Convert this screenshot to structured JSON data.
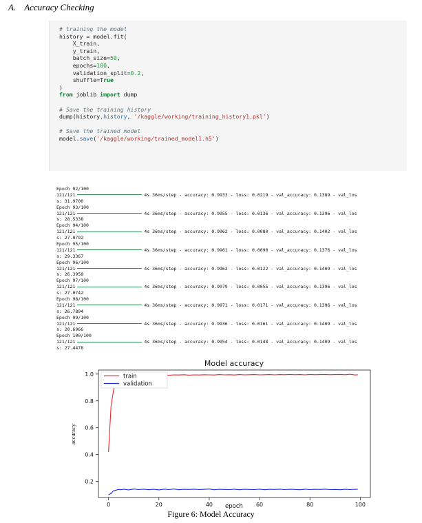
{
  "section": {
    "number": "A.",
    "title": "Accuracy Checking"
  },
  "code": {
    "comment_train": "# training the model",
    "line_fit": "history = model.fit(",
    "arg1": "X_train,",
    "arg2": "y_train,",
    "arg3_key": "batch_size=",
    "arg3_val": "50",
    "arg3_end": ",",
    "arg4_key": "epochs=",
    "arg4_val": "100",
    "arg4_end": ",",
    "arg5_key": "validation_split=",
    "arg5_val": "0.2",
    "arg5_end": ",",
    "arg6_key": "shuffle=",
    "arg6_val": "True",
    "close": ")",
    "import_from": "from",
    "import_mod": " joblib ",
    "import_kw": "import",
    "import_name": " dump",
    "comment_save_hist": "# Save the training history",
    "dump_call": "dump(history.",
    "dump_attr": "history",
    "dump_sep": ", ",
    "dump_path": "'/kaggle/working/training_history1.pkl'",
    "dump_end": ")",
    "comment_save_model": "# Save the trained model",
    "save_obj": "model.",
    "save_fn": "save",
    "save_open": "(",
    "save_path": "'/kaggle/working/trained_model1.h5'",
    "save_end": ")"
  },
  "log": {
    "epochs": [
      {
        "epoch": "Epoch 92/100",
        "step": "121/121",
        "stats": "4s 36ms/step - accuracy: 0.9933 - loss: 0.0219 - val_accuracy: 0.1389 - val_los",
        "tail": "s: 31.9700"
      },
      {
        "epoch": "Epoch 93/100",
        "step": "121/121",
        "stats": "4s 36ms/step - accuracy: 0.9955 - loss: 0.0136 - val_accuracy: 0.1396 - val_los",
        "tail": "s: 28.5338"
      },
      {
        "epoch": "Epoch 94/100",
        "step": "121/121",
        "stats": "4s 36ms/step - accuracy: 0.9962 - loss: 0.0080 - val_accuracy: 0.1402 - val_los",
        "tail": "s: 27.0792"
      },
      {
        "epoch": "Epoch 95/100",
        "step": "121/121",
        "stats": "4s 36ms/step - accuracy: 0.9961 - loss: 0.0090 - val_accuracy: 0.1376 - val_los",
        "tail": "s: 29.3367"
      },
      {
        "epoch": "Epoch 96/100",
        "step": "121/121",
        "stats": "4s 36ms/step - accuracy: 0.9962 - loss: 0.0122 - val_accuracy: 0.1409 - val_los",
        "tail": "s: 26.3958"
      },
      {
        "epoch": "Epoch 97/100",
        "step": "121/121",
        "stats": "4s 36ms/step - accuracy: 0.9979 - loss: 0.0055 - val_accuracy: 0.1396 - val_los",
        "tail": "s: 27.0742"
      },
      {
        "epoch": "Epoch 98/100",
        "step": "121/121",
        "stats": "4s 36ms/step - accuracy: 0.9971 - loss: 0.0171 - val_accuracy: 0.1396 - val_los",
        "tail": "s: 26.7894"
      },
      {
        "epoch": "Epoch 99/100",
        "step": "121/121",
        "stats": "4s 36ms/step - accuracy: 0.9936 - loss: 0.0161 - val_accuracy: 0.1409 - val_los",
        "tail": "s: 20.6966"
      },
      {
        "epoch": "Epoch 100/100",
        "step": "121/121",
        "stats": "4s 36ms/step - accuracy: 0.9954 - loss: 0.0148 - val_accuracy: 0.1409 - val_los",
        "tail": "s: 27.4478"
      }
    ]
  },
  "chart_data": {
    "type": "line",
    "title": "Model accuracy",
    "xlabel": "epoch",
    "ylabel": "accuracy",
    "xlim": [
      -4,
      104
    ],
    "ylim": [
      0.08,
      1.03
    ],
    "xticks": [
      0,
      20,
      40,
      60,
      80,
      100
    ],
    "yticks": [
      0.2,
      0.4,
      0.6,
      0.8,
      1.0
    ],
    "ytick_labels": [
      "0.2",
      "0.4",
      "0.6",
      "0.8",
      "1.0"
    ],
    "legend_position": "top-left",
    "series": [
      {
        "name": "train",
        "color": "#e8262b",
        "x": [
          0,
          1,
          2,
          3,
          4,
          5,
          6,
          7,
          8,
          9,
          10,
          11,
          12,
          13,
          14,
          15,
          16,
          17,
          18,
          19,
          20,
          22,
          24,
          26,
          28,
          30,
          32,
          34,
          36,
          38,
          40,
          42,
          44,
          46,
          48,
          50,
          52,
          54,
          56,
          58,
          60,
          62,
          64,
          66,
          68,
          70,
          72,
          74,
          76,
          78,
          80,
          82,
          84,
          86,
          88,
          90,
          92,
          94,
          96,
          98,
          99
        ],
        "y": [
          0.42,
          0.76,
          0.88,
          0.94,
          0.96,
          0.975,
          0.98,
          0.985,
          0.988,
          0.99,
          0.985,
          0.99,
          0.992,
          0.988,
          0.991,
          0.993,
          0.99,
          0.992,
          0.994,
          0.99,
          0.992,
          0.993,
          0.991,
          0.994,
          0.993,
          0.995,
          0.992,
          0.994,
          0.993,
          0.995,
          0.994,
          0.993,
          0.996,
          0.994,
          0.995,
          0.993,
          0.996,
          0.994,
          0.995,
          0.996,
          0.994,
          0.995,
          0.996,
          0.994,
          0.996,
          0.995,
          0.997,
          0.995,
          0.996,
          0.994,
          0.997,
          0.995,
          0.996,
          0.997,
          0.995,
          0.996,
          0.997,
          0.995,
          0.998,
          0.993,
          0.995
        ]
      },
      {
        "name": "validation",
        "color": "#1f2fd6",
        "x": [
          0,
          1,
          2,
          3,
          4,
          5,
          6,
          8,
          10,
          12,
          14,
          16,
          18,
          20,
          22,
          24,
          26,
          28,
          30,
          32,
          34,
          36,
          38,
          40,
          42,
          44,
          46,
          48,
          50,
          52,
          54,
          56,
          58,
          60,
          62,
          64,
          66,
          68,
          70,
          72,
          74,
          76,
          78,
          80,
          82,
          84,
          86,
          88,
          90,
          92,
          94,
          96,
          98,
          99
        ],
        "y": [
          0.1,
          0.11,
          0.13,
          0.135,
          0.14,
          0.138,
          0.142,
          0.137,
          0.143,
          0.139,
          0.142,
          0.138,
          0.141,
          0.137,
          0.142,
          0.139,
          0.143,
          0.138,
          0.141,
          0.14,
          0.142,
          0.139,
          0.141,
          0.143,
          0.138,
          0.141,
          0.14,
          0.139,
          0.142,
          0.138,
          0.141,
          0.14,
          0.139,
          0.142,
          0.138,
          0.141,
          0.14,
          0.142,
          0.139,
          0.141,
          0.14,
          0.138,
          0.142,
          0.139,
          0.141,
          0.14,
          0.142,
          0.139,
          0.14,
          0.138,
          0.141,
          0.139,
          0.141,
          0.141
        ]
      }
    ]
  },
  "caption": "Figure 6: Model Accuracy"
}
